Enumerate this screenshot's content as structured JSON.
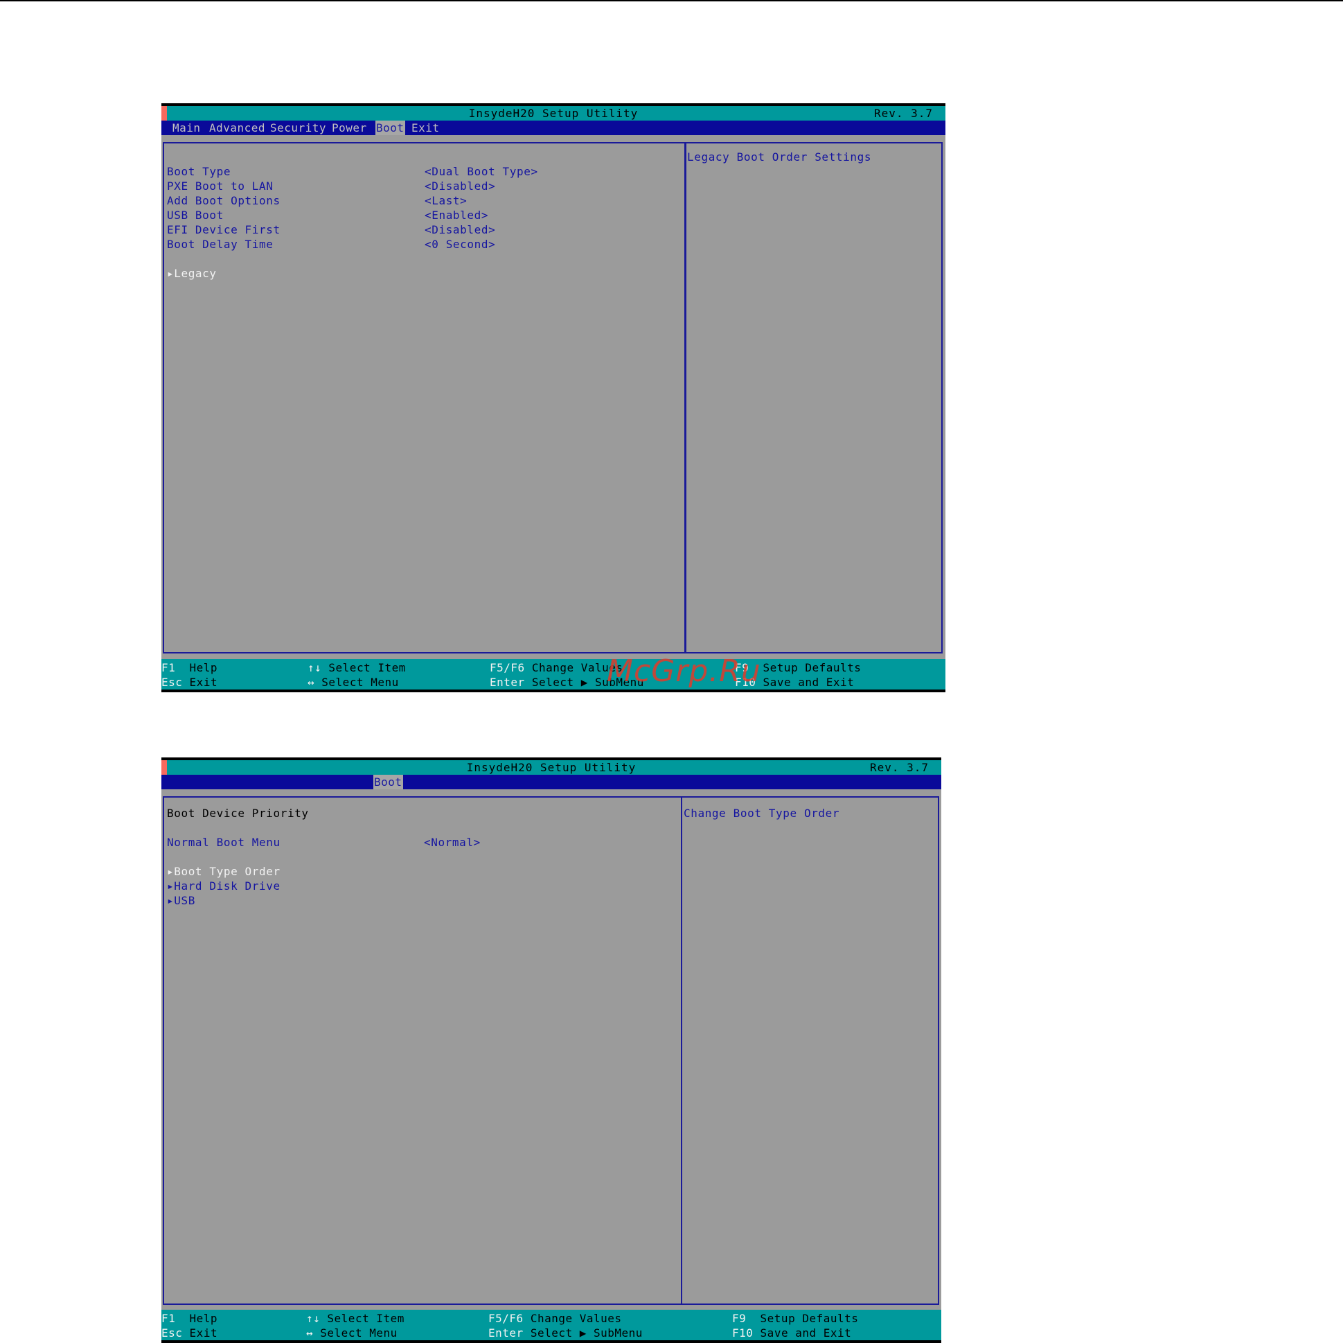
{
  "screen1": {
    "title": "InsydeH20 Setup Utility",
    "rev": "Rev. 3.7",
    "menu": [
      "Main",
      "Advanced",
      "Security",
      "Power",
      "Boot",
      "Exit"
    ],
    "active_menu": "Boot",
    "settings": [
      {
        "label": "Boot Type",
        "value": "<Dual Boot Type>"
      },
      {
        "label": "PXE Boot to LAN",
        "value": "<Disabled>"
      },
      {
        "label": "Add Boot Options",
        "value": "<Last>"
      },
      {
        "label": "USB Boot",
        "value": "<Enabled>"
      },
      {
        "label": "EFI Device First",
        "value": "<Disabled>"
      },
      {
        "label": "Boot Delay Time",
        "value": "<0 Second>"
      }
    ],
    "submenu": "Legacy",
    "help": "Legacy Boot Order Settings"
  },
  "screen2": {
    "title": "InsydeH20 Setup Utility",
    "rev": "Rev. 3.7",
    "active_menu": "Boot",
    "header": "Boot Device Priority",
    "setting": {
      "label": "Normal Boot Menu",
      "value": "<Normal>"
    },
    "submenus": [
      "Boot Type Order",
      "Hard Disk Drive",
      "USB"
    ],
    "help": "Change Boot Type Order"
  },
  "status": {
    "f1_key": "F1",
    "f1_text": "Help",
    "esc_key": "Esc",
    "esc_text": "Exit",
    "ud_key": "↑↓",
    "ud_text": "Select Item",
    "lr_key": "↔",
    "lr_text": "Select Menu",
    "f5_key": "F5/F6",
    "f5_text": "Change Values",
    "enter_key": "Enter",
    "enter_text": "Select ▶ SubMenu",
    "f9_key": "F9",
    "f9_text": "Setup Defaults",
    "f10_key": "F10",
    "f10_text": "Save and Exit"
  },
  "watermark": "McGrp.Ru",
  "colors": {
    "panel_gray": "#9b9b9b",
    "teal": "#00999c",
    "menu_blue": "#0a0a99",
    "text_blue": "#1515a0",
    "accent_red": "#f76a5e"
  }
}
